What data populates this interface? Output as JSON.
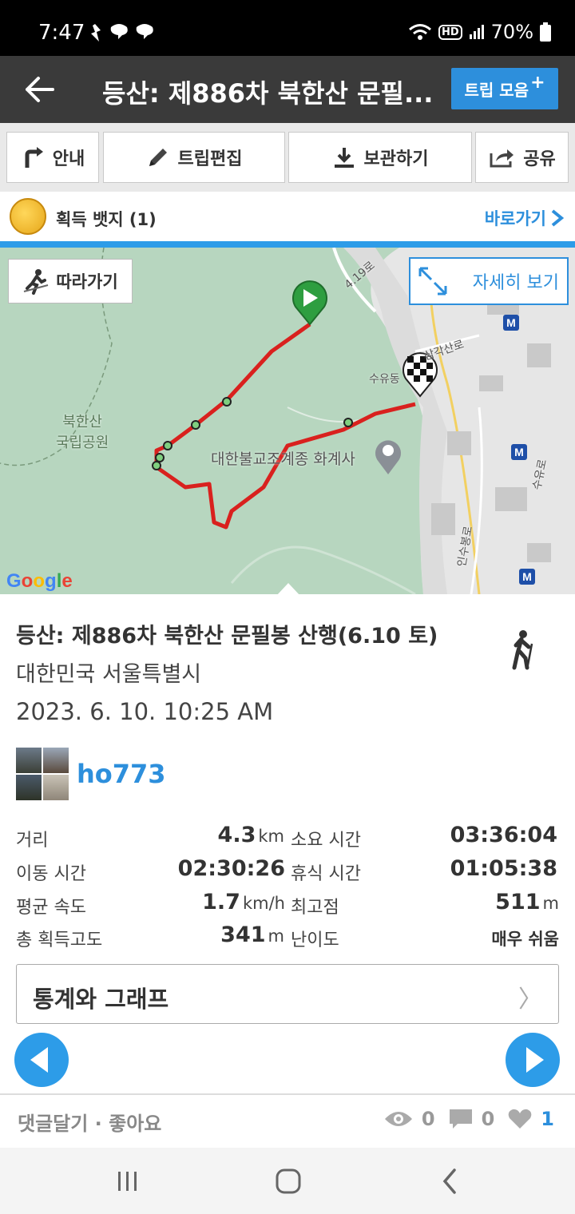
{
  "status_bar": {
    "time": "7:47",
    "battery": "70%",
    "hd": "HD"
  },
  "header": {
    "title": "등산: 제886차 북한산 문필...",
    "collect_label": "트립 모음",
    "collect_plus": "+"
  },
  "toolbar": {
    "guide": "안내",
    "edit": "트립편집",
    "save": "보관하기",
    "share": "공유"
  },
  "badges": {
    "label": "획득 뱃지 (1)",
    "goto": "바로가기"
  },
  "map": {
    "follow": "따라가기",
    "detail": "자세히 보기",
    "labels": {
      "park": "북한산\n국립공원",
      "temple": "대한불교조계종 화계사",
      "road1": "4.19로",
      "road2": "삼각산로",
      "suyu": "수유동",
      "road3": "수유로",
      "road4": "인수봉로"
    },
    "google": "Google"
  },
  "trip": {
    "title": "등산: 제886차 북한산 문필봉 산행(6.10 토)",
    "location": "대한민국 서울특별시",
    "date": "2023. 6. 10. 10:25 AM",
    "user": "ho773"
  },
  "stats": {
    "distance_label": "거리",
    "distance": "4.3",
    "distance_unit": "km",
    "duration_label": "소요 시간",
    "duration": "03:36:04",
    "moving_label": "이동 시간",
    "moving": "02:30:26",
    "rest_label": "휴식 시간",
    "rest": "01:05:38",
    "speed_label": "평균 속도",
    "speed": "1.7",
    "speed_unit": "km/h",
    "max_label": "최고점",
    "max": "511",
    "max_unit": "m",
    "gain_label": "총 획득고도",
    "gain": "341",
    "gain_unit": "m",
    "difficulty_label": "난이도",
    "difficulty": "매우 쉬움"
  },
  "graph_button": {
    "label": "통계와 그래프",
    "chevron": "〉"
  },
  "footer": {
    "comment_like": "댓글달기 · 좋아요",
    "views": "0",
    "comments": "0",
    "likes": "1"
  },
  "colors": {
    "accent": "#2d8fdc",
    "route": "#d9211e",
    "header": "#3a3a3a"
  }
}
